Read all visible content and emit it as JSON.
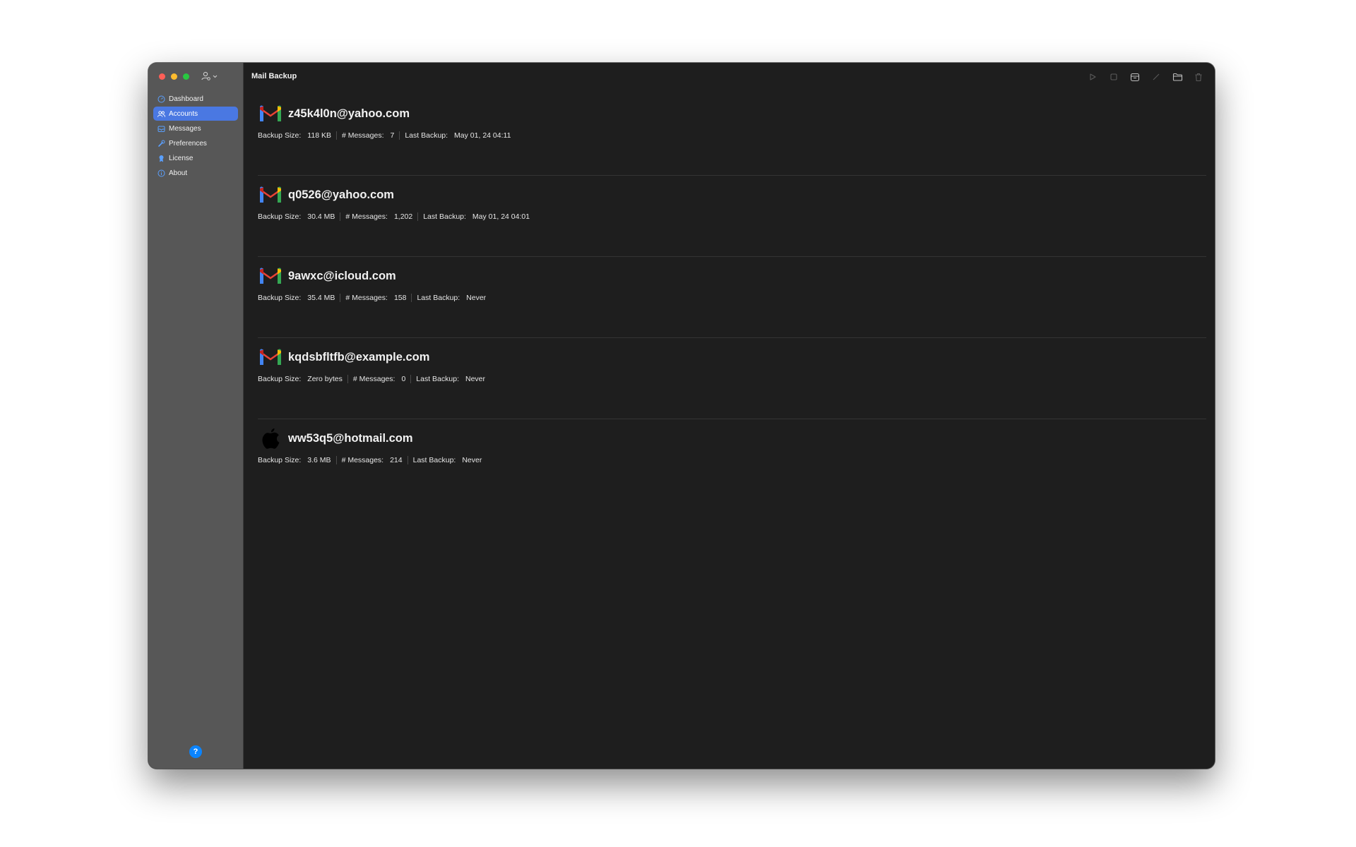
{
  "window": {
    "title": "Mail Backup"
  },
  "sidebar": {
    "items": [
      {
        "label": "Dashboard",
        "icon": "dashboard-icon",
        "active": false
      },
      {
        "label": "Accounts",
        "icon": "accounts-icon",
        "active": true
      },
      {
        "label": "Messages",
        "icon": "messages-icon",
        "active": false
      },
      {
        "label": "Preferences",
        "icon": "preferences-icon",
        "active": false
      },
      {
        "label": "License",
        "icon": "license-icon",
        "active": false
      },
      {
        "label": "About",
        "icon": "about-icon",
        "active": false
      }
    ],
    "help_label": "?"
  },
  "toolbar": {
    "buttons": [
      "play-icon",
      "stop-icon",
      "archive-icon",
      "edit-icon",
      "folder-icon",
      "trash-icon"
    ]
  },
  "labels": {
    "backup_size": "Backup Size:",
    "messages": "# Messages:",
    "last_backup": "Last Backup:"
  },
  "accounts": [
    {
      "email": "z45k4l0n@yahoo.com",
      "provider": "gmail",
      "backup_size": "118 KB",
      "messages": "7",
      "last_backup": "May 01, 24 04:11"
    },
    {
      "email": "q0526@yahoo.com",
      "provider": "gmail",
      "backup_size": "30.4 MB",
      "messages": "1,202",
      "last_backup": "May 01, 24 04:01"
    },
    {
      "email": "9awxc@icloud.com",
      "provider": "gmail",
      "backup_size": "35.4 MB",
      "messages": "158",
      "last_backup": "Never"
    },
    {
      "email": "kqdsbfltfb@example.com",
      "provider": "gmail",
      "backup_size": "Zero bytes",
      "messages": "0",
      "last_backup": "Never"
    },
    {
      "email": "ww53q5@hotmail.com",
      "provider": "apple",
      "backup_size": "3.6 MB",
      "messages": "214",
      "last_backup": "Never"
    }
  ],
  "colors": {
    "accent": "#4a78e2",
    "window_bg": "#1e1e1e",
    "sidebar_bg": "#575757",
    "help_button": "#0a84ff"
  }
}
